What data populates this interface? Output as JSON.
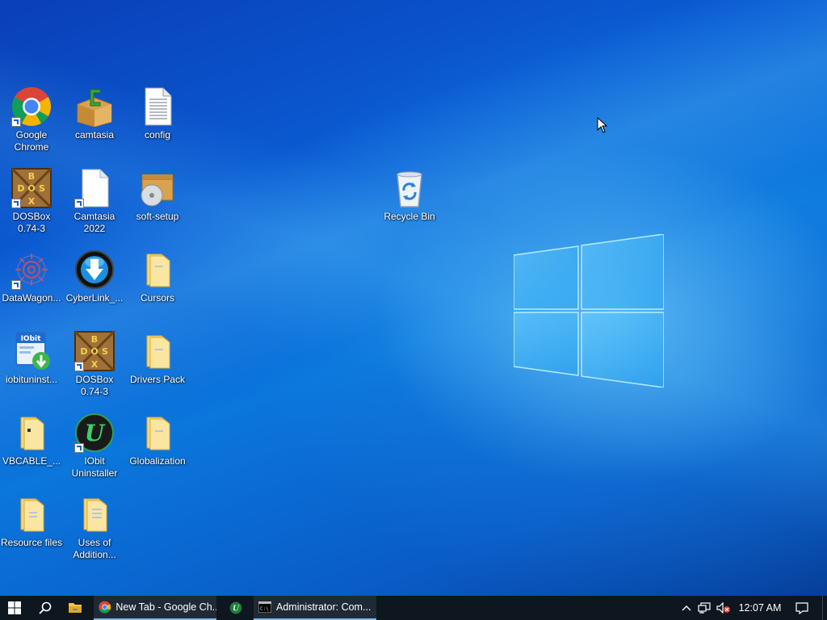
{
  "desktop": {
    "icons": [
      {
        "label": "Google\nChrome",
        "icon": "chrome-icon",
        "shortcut": true
      },
      {
        "label": "camtasia",
        "icon": "package-icon",
        "shortcut": false
      },
      {
        "label": "config",
        "icon": "text-file-icon",
        "shortcut": false
      },
      {
        "label": "DOSBox\n0.74-3",
        "icon": "dosbox-icon",
        "shortcut": true
      },
      {
        "label": "Camtasia\n2022",
        "icon": "blank-file-icon",
        "shortcut": true
      },
      {
        "label": "soft-setup",
        "icon": "setup-disc-icon",
        "shortcut": false
      },
      {
        "label": "DataWagon...",
        "icon": "gear-cluster-icon",
        "shortcut": true
      },
      {
        "label": "CyberLink_...",
        "icon": "download-orb-icon",
        "shortcut": false
      },
      {
        "label": "Cursors",
        "icon": "folder-icon",
        "shortcut": false
      },
      {
        "label": "iobituninst...",
        "icon": "iobit-installer-icon",
        "shortcut": false
      },
      {
        "label": "DOSBox\n0.74-3",
        "icon": "dosbox-icon",
        "shortcut": true
      },
      {
        "label": "Drivers Pack",
        "icon": "folder-icon",
        "shortcut": false
      },
      {
        "label": "VBCABLE_...",
        "icon": "folder-icon",
        "shortcut": false
      },
      {
        "label": "IObit\nUninstaller",
        "icon": "iobit-uninstaller-icon",
        "shortcut": true
      },
      {
        "label": "Globalization",
        "icon": "folder-icon",
        "shortcut": false
      },
      {
        "label": "Resource files",
        "icon": "folder-icon",
        "shortcut": false
      },
      {
        "label": "Uses of\nAddition...",
        "icon": "folder-icon",
        "shortcut": false
      },
      {
        "label": "Recycle Bin",
        "icon": "recycle-bin-icon",
        "shortcut": false
      }
    ]
  },
  "taskbar": {
    "apps": [
      {
        "label": "New Tab - Google Ch...",
        "icon": "chrome-icon",
        "active": true
      },
      {
        "label": "",
        "icon": "iobit-uninstaller-icon",
        "active": false
      },
      {
        "label": "Administrator:  Com...",
        "icon": "cmd-icon",
        "active": true
      }
    ],
    "clock": "12:07 AM"
  },
  "colors": {
    "taskbar_bg": "#0e1620",
    "active_underline": "#76b9ed",
    "desktop_blue": "#0b76dc"
  }
}
